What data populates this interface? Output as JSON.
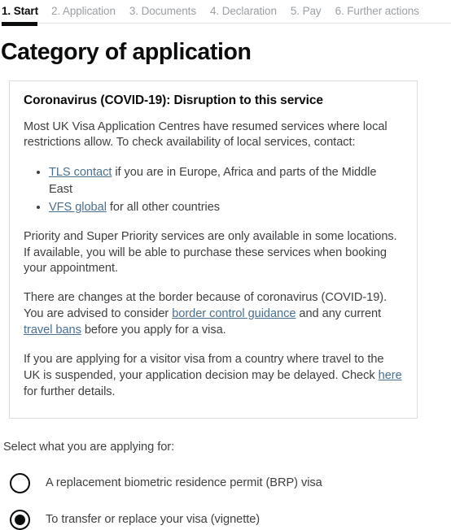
{
  "progress_nav": {
    "steps": [
      {
        "label": "1. Start",
        "current": true
      },
      {
        "label": "2. Application",
        "current": false
      },
      {
        "label": "3. Documents",
        "current": false
      },
      {
        "label": "4. Declaration",
        "current": false
      },
      {
        "label": "5. Pay",
        "current": false
      },
      {
        "label": "6. Further actions",
        "current": false
      }
    ]
  },
  "page": {
    "title": "Category of application"
  },
  "notice": {
    "title": "Coronavirus (COVID-19): Disruption to this service",
    "para1": "Most UK Visa Application Centres have resumed services where local restrictions allow. To check availability of local services, contact:",
    "bullets": [
      {
        "link": "TLS contact",
        "rest": " if you are in Europe, Africa and parts of the Middle East"
      },
      {
        "link": "VFS global",
        "rest": " for all other countries"
      }
    ],
    "para2": "Priority and Super Priority services are only available in some locations. If available, you will be able to purchase these services when booking your appointment.",
    "para3_a": "There are changes at the border because of coronavirus (COVID-19). You are advised to consider ",
    "para3_link1": "border control guidance",
    "para3_b": " and any current ",
    "para3_link2": "travel bans",
    "para3_c": " before you apply for a visa.",
    "para4_a": "If you are applying for a visitor visa from a country where travel to the UK is suspended, your application decision may be delayed. Check ",
    "para4_link": "here",
    "para4_b": " for further details."
  },
  "question": {
    "label": "Select what you are applying for:",
    "options": [
      {
        "label": "A replacement biometric residence permit (BRP) visa",
        "selected": false
      },
      {
        "label": "To transfer or replace your visa (vignette)",
        "selected": true
      }
    ]
  },
  "colors": {
    "text": "#0b0c0c",
    "body_text": "#3d3f41",
    "muted": "#9ba0a5",
    "link": "#4a6f8e",
    "border": "#dcdcdc",
    "rule": "#e6e6e6"
  }
}
